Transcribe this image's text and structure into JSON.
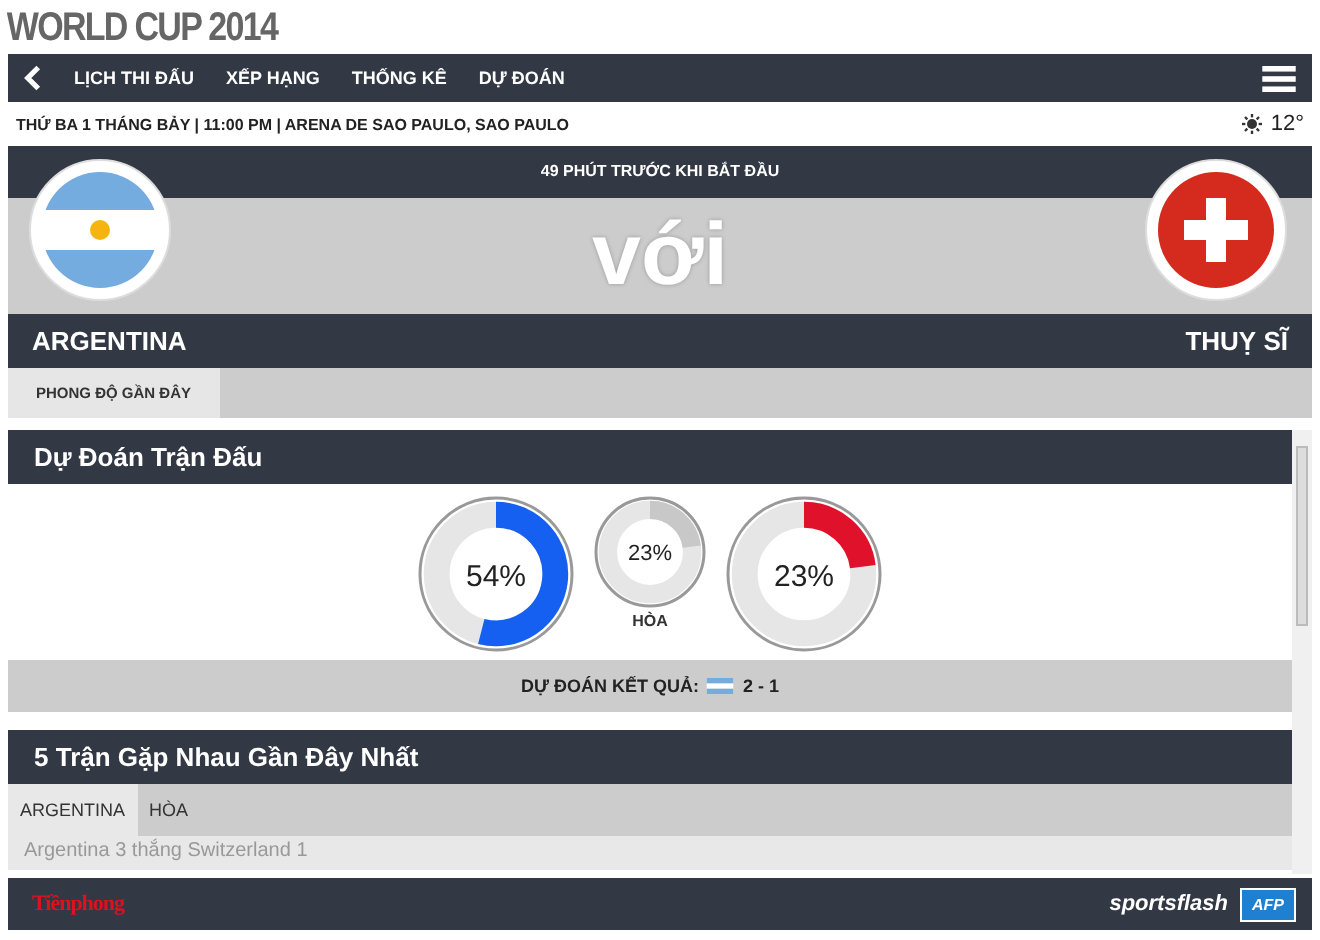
{
  "page_title": "WORLD CUP 2014",
  "nav": {
    "items": [
      {
        "label": "LỊCH THI ĐẤU"
      },
      {
        "label": "XẾP HẠNG"
      },
      {
        "label": "THỐNG KÊ"
      },
      {
        "label": "DỰ ĐOÁN"
      }
    ]
  },
  "match_info": "THỨ BA 1 THÁNG BẢY | 11:00 PM | ARENA DE SAO PAULO, SAO PAULO",
  "weather": "12°",
  "countdown": "49 PHÚT TRƯỚC KHI BẮT ĐẦU",
  "versus": "với",
  "home_team": "ARGENTINA",
  "away_team": "THUỴ SĨ",
  "form_tabs": [
    {
      "label": "PHONG ĐỘ GẦN ĐÂY",
      "selected": true
    }
  ],
  "prediction": {
    "title": "Dự Đoán Trận Đấu",
    "donuts": [
      {
        "value": "54%",
        "color": "#1560f0"
      },
      {
        "value": "23%",
        "color": "#c8c8c8",
        "label": "HÒA"
      },
      {
        "value": "23%",
        "color": "#e0112b"
      }
    ],
    "result_label": "DỰ ĐOÁN KẾT QUẢ:",
    "result_score": "2 - 1"
  },
  "head_to_head": {
    "title": "5 Trận Gặp Nhau Gần Đây Nhất",
    "tabs": [
      {
        "label": "ARGENTINA",
        "selected": true
      },
      {
        "label": "HÒA",
        "selected": false
      }
    ],
    "rows": [
      "Argentina 3 thắng Switzerland 1"
    ]
  },
  "footer": {
    "left_logo": "Tiềnphong",
    "right_logo": "sportsflash",
    "badge": "AFP"
  }
}
